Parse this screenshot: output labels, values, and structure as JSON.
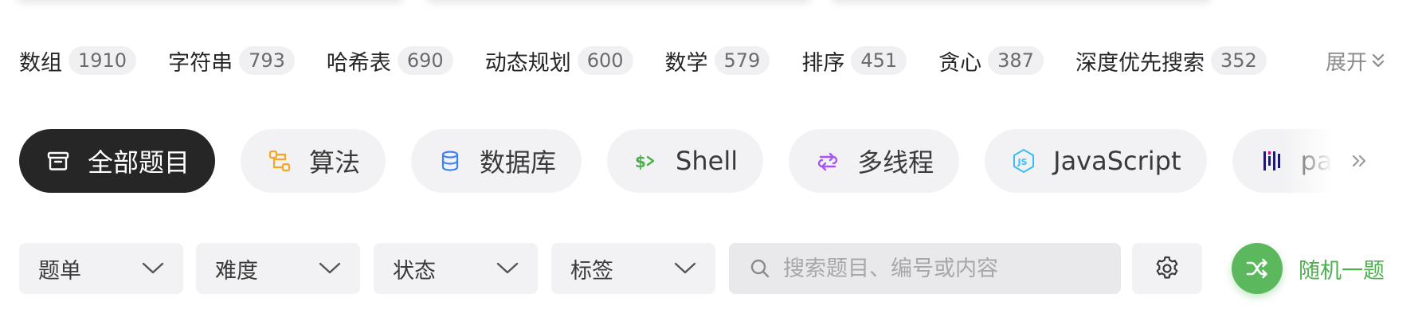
{
  "tags": [
    {
      "name": "数组",
      "count": "1910"
    },
    {
      "name": "字符串",
      "count": "793"
    },
    {
      "name": "哈希表",
      "count": "690"
    },
    {
      "name": "动态规划",
      "count": "600"
    },
    {
      "name": "数学",
      "count": "579"
    },
    {
      "name": "排序",
      "count": "451"
    },
    {
      "name": "贪心",
      "count": "387"
    },
    {
      "name": "深度优先搜索",
      "count": "352"
    }
  ],
  "expand_label": "展开",
  "categories": [
    {
      "label": "全部题目",
      "icon": "inbox-icon",
      "active": true
    },
    {
      "label": "算法",
      "icon": "flow-icon",
      "color": "#f5a623"
    },
    {
      "label": "数据库",
      "icon": "database-icon",
      "color": "#3b82f6"
    },
    {
      "label": "Shell",
      "icon": "shell-icon",
      "color": "#4cae4c"
    },
    {
      "label": "多线程",
      "icon": "threads-icon",
      "color": "#a855f7"
    },
    {
      "label": "JavaScript",
      "icon": "js-icon",
      "color": "#38bdf8"
    },
    {
      "label": "pandas",
      "icon": "pandas-icon",
      "color": "#1e1b6b"
    }
  ],
  "filters": {
    "list": "题单",
    "difficulty": "难度",
    "status": "状态",
    "tags": "标签"
  },
  "search": {
    "placeholder": "搜索题目、编号或内容"
  },
  "random": {
    "label": "随机一题"
  },
  "colors": {
    "accent_green": "#5cb85c",
    "pill_bg": "#f2f2f4",
    "active_bg": "#262626"
  }
}
